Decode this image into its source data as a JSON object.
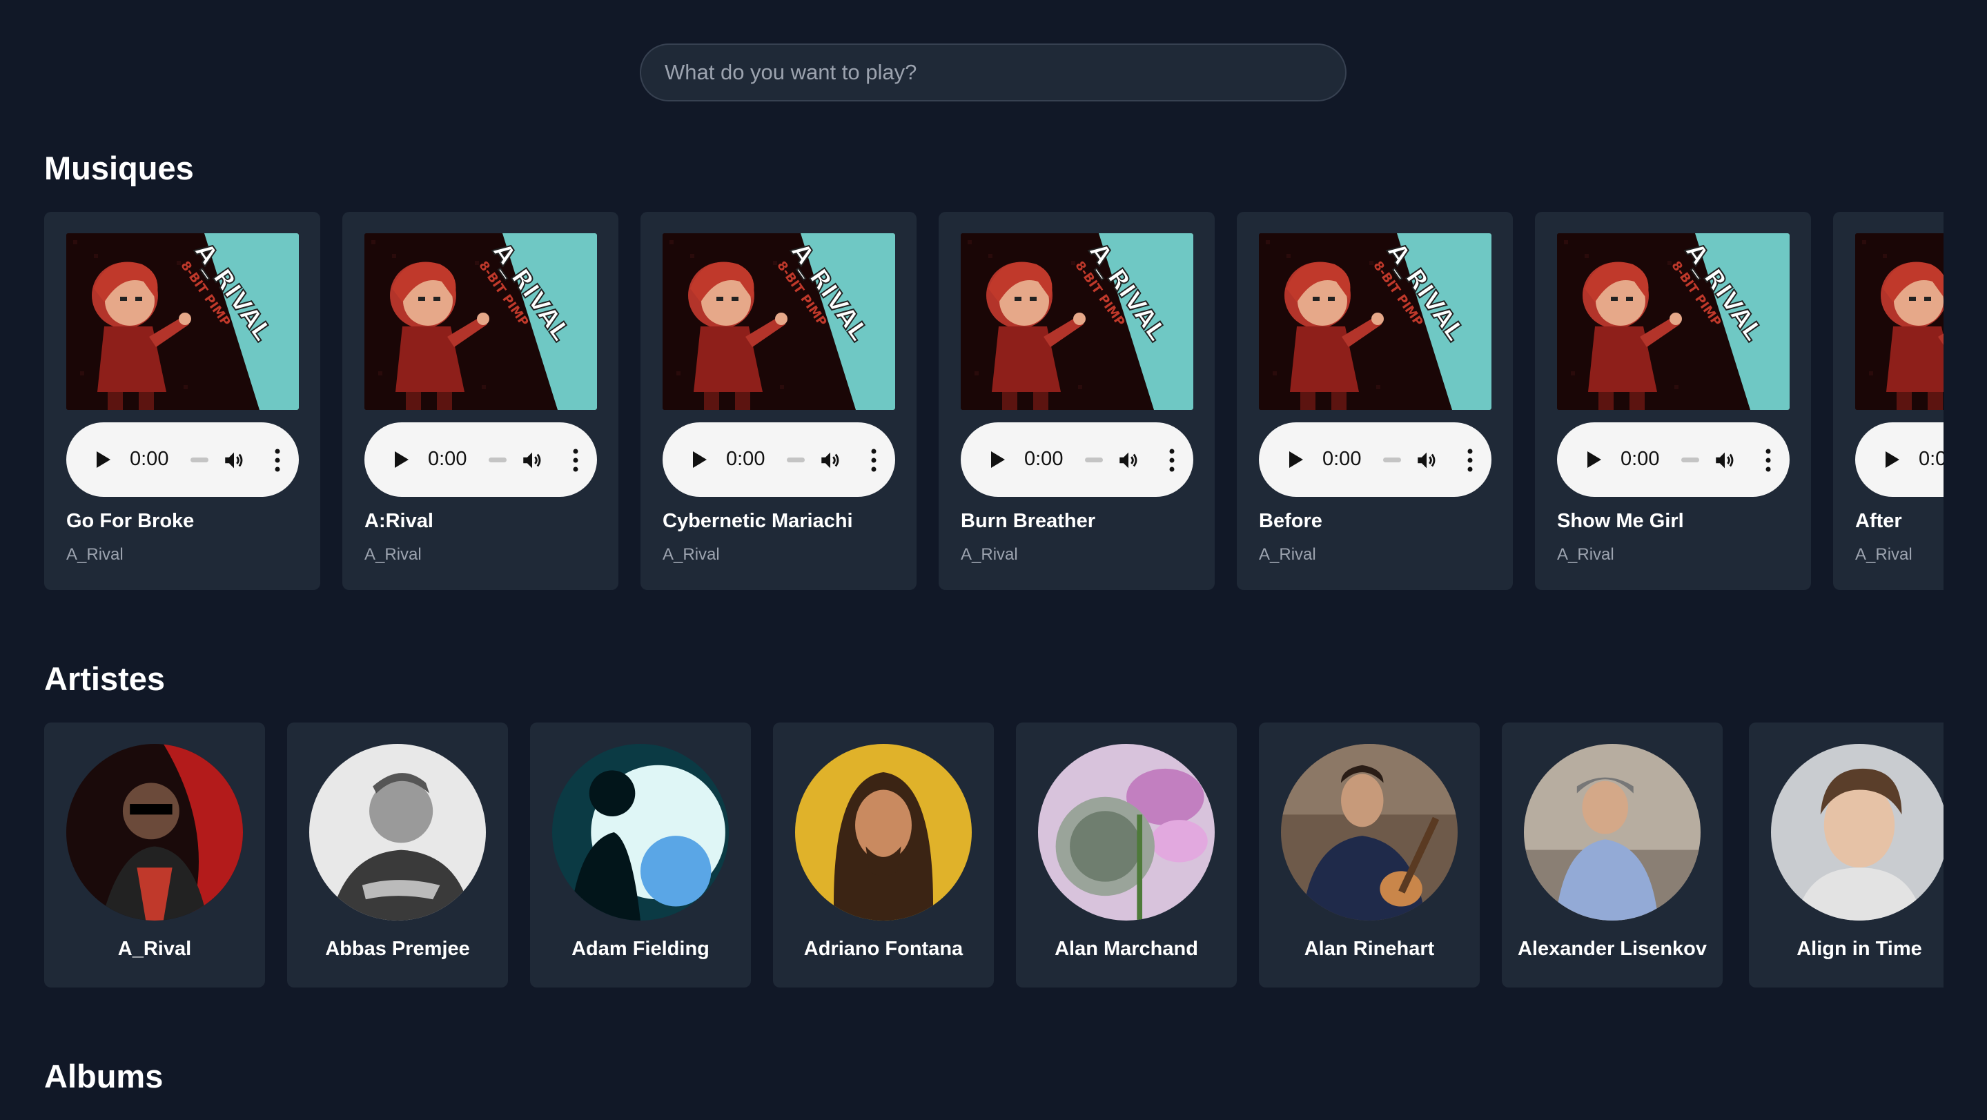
{
  "search": {
    "placeholder": "What do you want to play?"
  },
  "sections": {
    "songs_title": "Musiques",
    "artists_title": "Artistes",
    "albums_title": "Albums"
  },
  "cover_art": {
    "title_text": "A_RIVAL",
    "subtitle_text": "8-BIT PIMP"
  },
  "songs": [
    {
      "title": "Go For Broke",
      "artist": "A_Rival",
      "time": "0:00"
    },
    {
      "title": "A:Rival",
      "artist": "A_Rival",
      "time": "0:00"
    },
    {
      "title": "Cybernetic Mariachi",
      "artist": "A_Rival",
      "time": "0:00"
    },
    {
      "title": "Burn Breather",
      "artist": "A_Rival",
      "time": "0:00"
    },
    {
      "title": "Before",
      "artist": "A_Rival",
      "time": "0:00"
    },
    {
      "title": "Show Me Girl",
      "artist": "A_Rival",
      "time": "0:00"
    },
    {
      "title": "After",
      "artist": "A_Rival",
      "time": "0:00"
    }
  ],
  "artists": [
    {
      "name": "A_Rival"
    },
    {
      "name": "Abbas Premjee"
    },
    {
      "name": "Adam Fielding"
    },
    {
      "name": "Adriano Fontana"
    },
    {
      "name": "Alan Marchand"
    },
    {
      "name": "Alan Rinehart"
    },
    {
      "name": "Alexander Lisenkov"
    },
    {
      "name": "Align in Time"
    }
  ],
  "colors": {
    "background": "#111827",
    "card": "#1f2937",
    "muted_text": "#9ca3af",
    "cover_teal": "#6fc8c4"
  }
}
